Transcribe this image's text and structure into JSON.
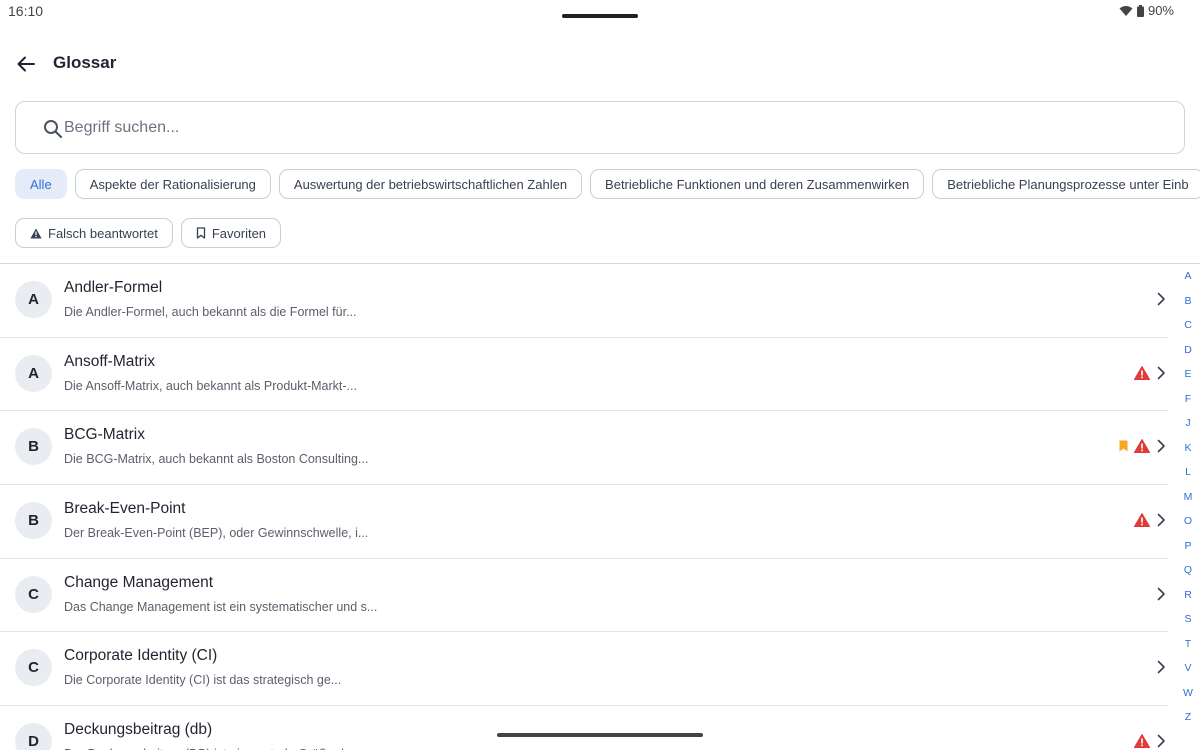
{
  "status_bar": {
    "time": "16:10",
    "battery": "90%"
  },
  "header": {
    "title": "Glossar"
  },
  "search": {
    "placeholder": "Begriff suchen...",
    "value": ""
  },
  "filters": {
    "categories": [
      {
        "label": "Alle",
        "active": true
      },
      {
        "label": "Aspekte der Rationalisierung",
        "active": false
      },
      {
        "label": "Auswertung der betriebswirtschaftlichen Zahlen",
        "active": false
      },
      {
        "label": "Betriebliche Funktionen und deren Zusammenwirken",
        "active": false
      },
      {
        "label": "Betriebliche Planungsprozesse unter Einb",
        "active": false
      }
    ],
    "wrong_label": "Falsch beantwortet",
    "favorites_label": "Favoriten"
  },
  "terms": [
    {
      "letter": "A",
      "title": "Andler-Formel",
      "desc": "Die Andler-Formel, auch bekannt als die Formel für...",
      "bookmark": false,
      "warning": false
    },
    {
      "letter": "A",
      "title": "Ansoff-Matrix",
      "desc": "Die Ansoff-Matrix, auch bekannt als Produkt-Markt-...",
      "bookmark": false,
      "warning": true
    },
    {
      "letter": "B",
      "title": "BCG-Matrix",
      "desc": "Die BCG-Matrix, auch bekannt als Boston Consulting...",
      "bookmark": true,
      "warning": true
    },
    {
      "letter": "B",
      "title": "Break-Even-Point",
      "desc": "Der Break-Even-Point (BEP), oder Gewinnschwelle, i...",
      "bookmark": false,
      "warning": true
    },
    {
      "letter": "C",
      "title": "Change Management",
      "desc": "Das Change Management ist ein systematischer und s...",
      "bookmark": false,
      "warning": false
    },
    {
      "letter": "C",
      "title": "Corporate Identity (CI)",
      "desc": "Die Corporate Identity (CI) ist das strategisch ge...",
      "bookmark": false,
      "warning": false
    },
    {
      "letter": "D",
      "title": "Deckungsbeitrag (db)",
      "desc": "Der Deckungsbeitrag (DB) ist ein zentrale Größe d...",
      "bookmark": false,
      "warning": true
    }
  ],
  "index_letters": [
    "A",
    "B",
    "C",
    "D",
    "E",
    "F",
    "J",
    "K",
    "L",
    "M",
    "O",
    "P",
    "Q",
    "R",
    "S",
    "T",
    "V",
    "W",
    "Z"
  ],
  "colors": {
    "accent": "#2f6fd6",
    "warning": "#e03b3b",
    "bookmark": "#f5a623"
  }
}
